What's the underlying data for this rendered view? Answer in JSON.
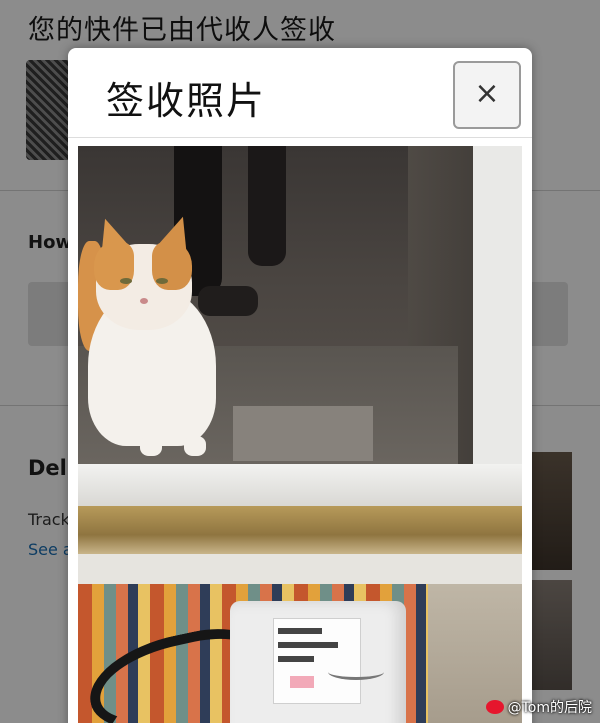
{
  "background": {
    "header_text": "您的快件已由代收人签收",
    "section_how": "How",
    "section_delivery": "Del",
    "tracking_text": "Track",
    "see_link": "See a"
  },
  "modal": {
    "title": "签收照片",
    "close_label": "×"
  },
  "photo": {
    "description_icon": "delivery-photo",
    "colors": {
      "cat_orange": "#d9974d",
      "cat_white": "#f4f1ec"
    }
  },
  "watermark": {
    "text": "@Tom的后院",
    "icon": "weibo-icon"
  }
}
